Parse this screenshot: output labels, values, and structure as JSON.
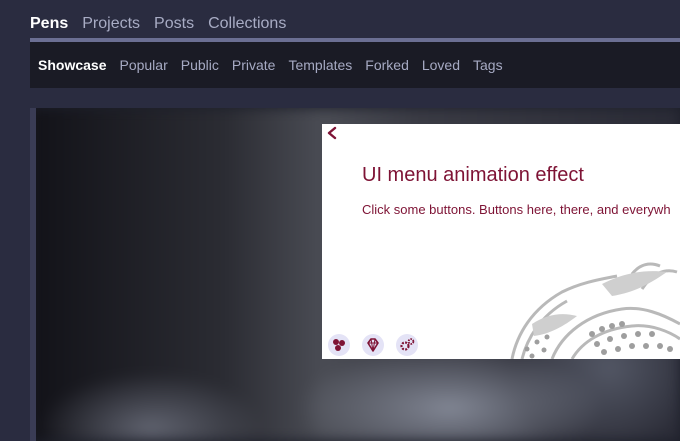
{
  "top_tabs": [
    "Pens",
    "Projects",
    "Posts",
    "Collections"
  ],
  "sub_nav": [
    "Showcase",
    "Popular",
    "Public",
    "Private",
    "Templates",
    "Forked",
    "Loved",
    "Tags"
  ],
  "preview": {
    "title": "UI menu animation effect",
    "subtitle": "Click some buttons. Buttons here, there, and everywh"
  },
  "icons": {
    "back": "chevron-left-icon",
    "buttons": [
      "molecule-icon",
      "diamond-icon",
      "gears-icon"
    ]
  },
  "colors": {
    "accent_text": "#7e1335",
    "nav_bg": "#1a1b25",
    "page_bg": "#2a2c40"
  }
}
